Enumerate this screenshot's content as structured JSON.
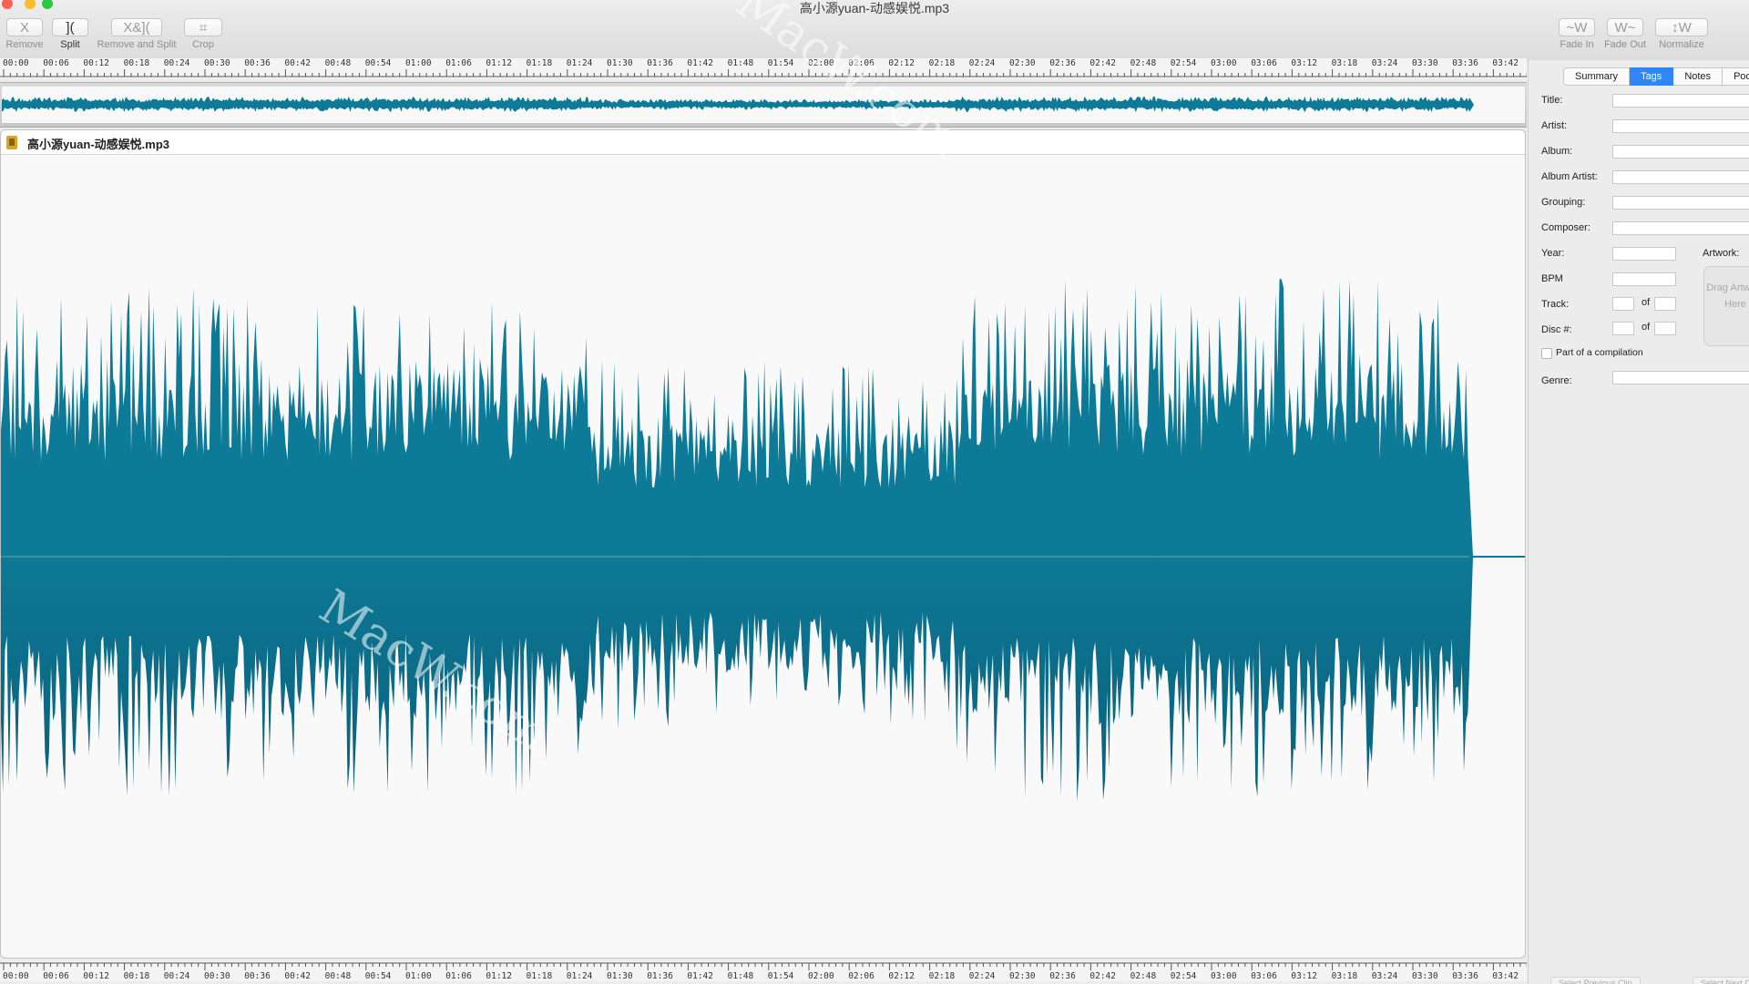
{
  "window": {
    "title": "高小源yuan-动感娱悦.mp3"
  },
  "toolbar": {
    "left": [
      {
        "id": "remove",
        "label": "Remove",
        "icon_glyph": "X",
        "icon": "scissors-x-icon",
        "active": false
      },
      {
        "id": "split",
        "label": "Split",
        "icon_glyph": "](",
        "icon": "split-bracket-icon",
        "active": true
      },
      {
        "id": "remove-and-split",
        "label": "Remove and Split",
        "icon_glyph": "X&](",
        "icon": "remove-split-icon",
        "active": false
      },
      {
        "id": "crop",
        "label": "Crop",
        "icon_glyph": "⌗",
        "icon": "crop-icon",
        "active": false
      }
    ],
    "right": [
      {
        "id": "fade-in",
        "label": "Fade In",
        "icon_glyph": "~W",
        "icon": "fade-in-wave-icon"
      },
      {
        "id": "fade-out",
        "label": "Fade Out",
        "icon_glyph": "W~",
        "icon": "fade-out-wave-icon"
      },
      {
        "id": "normalize",
        "label": "Normalize",
        "icon_glyph": "↕W",
        "icon": "normalize-wave-icon"
      }
    ]
  },
  "ruler_ticks": [
    "00:00",
    "00:06",
    "00:12",
    "00:18",
    "00:24",
    "00:30",
    "00:36",
    "00:42",
    "00:48",
    "00:54",
    "01:00",
    "01:06",
    "01:12",
    "01:18",
    "01:24",
    "01:30",
    "01:36",
    "01:42",
    "01:48",
    "01:54",
    "02:00",
    "02:06",
    "02:12",
    "02:18",
    "02:24",
    "02:30",
    "02:36",
    "02:42",
    "02:48",
    "02:54",
    "03:00",
    "03:06",
    "03:12",
    "03:18",
    "03:24",
    "03:30",
    "03:36",
    "03:42"
  ],
  "clip": {
    "name": "高小源yuan-动感娱悦.mp3",
    "wave_color": "#0d7b98",
    "wave_color_dark": "#0a5f7a"
  },
  "watermark": "MacW.com",
  "tabs": [
    {
      "label": "Summary",
      "active": false
    },
    {
      "label": "Tags",
      "active": true
    },
    {
      "label": "Notes",
      "active": false
    },
    {
      "label": "Podcast",
      "active": false
    }
  ],
  "tags_form": {
    "title_label": "Title:",
    "artist_label": "Artist:",
    "album_label": "Album:",
    "album_artist_label": "Album Artist:",
    "grouping_label": "Grouping:",
    "composer_label": "Composer:",
    "year_label": "Year:",
    "artwork_label": "Artwork:",
    "bpm_label": "BPM",
    "track_label": "Track:",
    "disc_label": "Disc #:",
    "of_label": "of",
    "compilation_label": "Part of a compilation",
    "genre_label": "Genre:",
    "artwork_placeholder": "Drag Artwork Here",
    "title": "",
    "artist": "",
    "album": "",
    "album_artist": "",
    "grouping": "",
    "composer": "",
    "year": "",
    "bpm": "",
    "track": "",
    "track_of": "",
    "disc": "",
    "disc_of": "",
    "genre": ""
  },
  "footer": {
    "select_previous": "Select Previous Clip",
    "select_next": "Select Next Clip"
  }
}
